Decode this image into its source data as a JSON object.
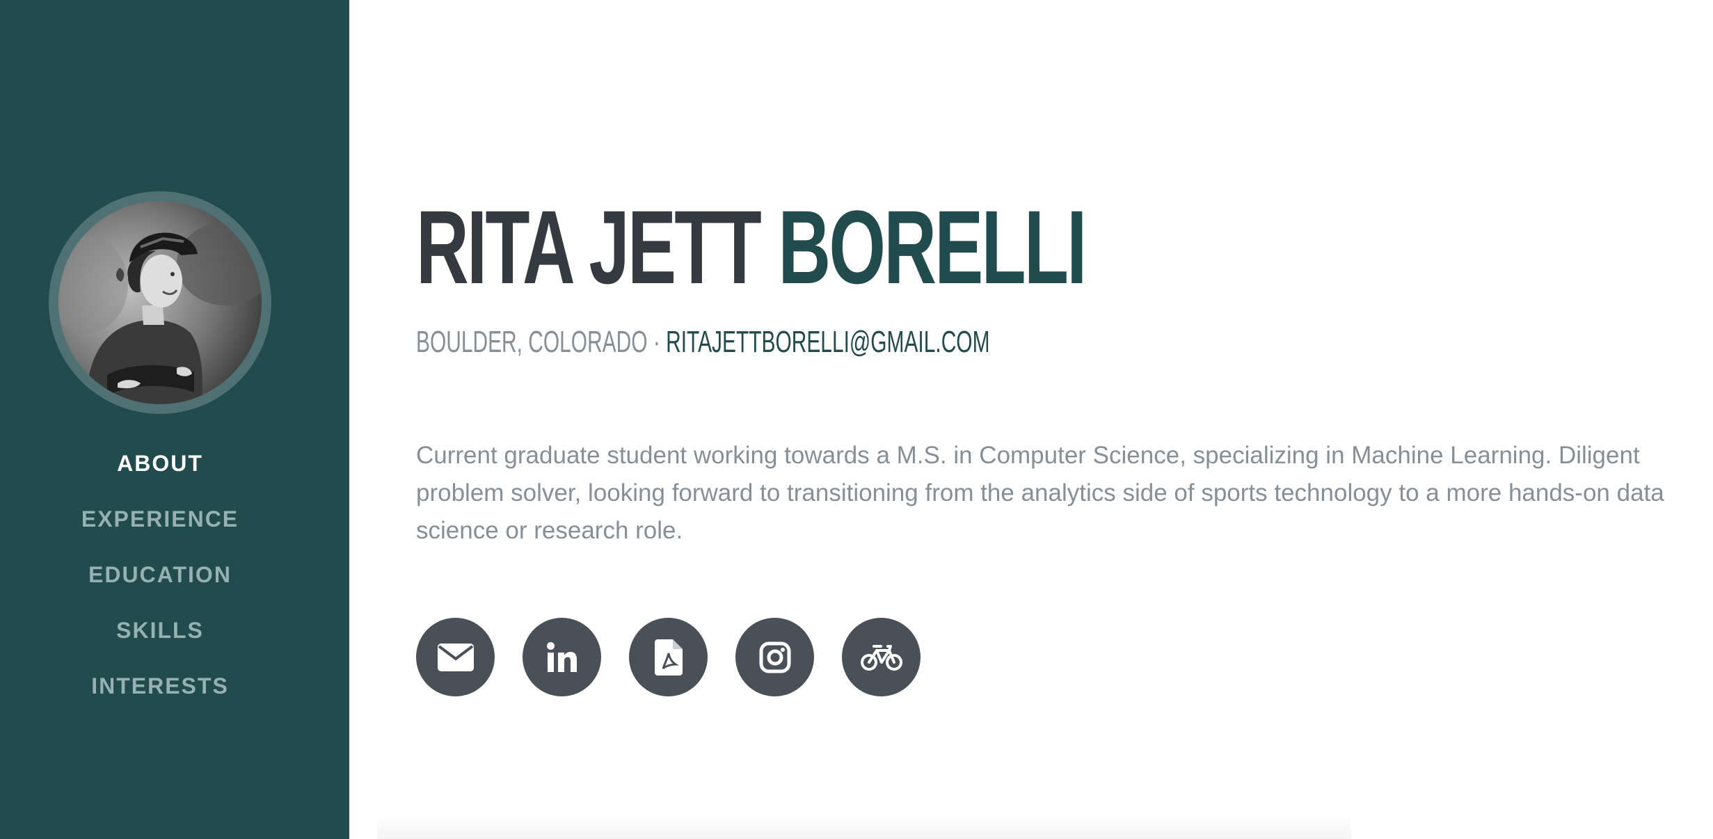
{
  "sidebar": {
    "avatar_alt": "Profile photo",
    "nav": [
      {
        "label": "ABOUT",
        "active": true
      },
      {
        "label": "EXPERIENCE",
        "active": false
      },
      {
        "label": "EDUCATION",
        "active": false
      },
      {
        "label": "SKILLS",
        "active": false
      },
      {
        "label": "INTERESTS",
        "active": false
      }
    ]
  },
  "header": {
    "first_name": "RITA JETT",
    "last_name": "BORELLI",
    "location": "BOULDER, COLORADO",
    "separator": "·",
    "email": "RITAJETTBORELLI@GMAIL.COM"
  },
  "about": {
    "bio": "Current graduate student working towards a M.S. in Computer Science, specializing in Machine Learning. Diligent problem solver, looking forward to transitioning from the analytics side of sports technology to a more hands-on data science or research role."
  },
  "social": [
    {
      "icon": "envelope-icon"
    },
    {
      "icon": "linkedin-icon"
    },
    {
      "icon": "pdf-file-icon"
    },
    {
      "icon": "instagram-icon"
    },
    {
      "icon": "bicycle-icon"
    }
  ],
  "colors": {
    "sidebar_bg": "#224b4d",
    "nav_active": "#ffffff",
    "nav_inactive": "#96b1b1",
    "name_dark": "#343a40",
    "accent": "#224b4d",
    "muted_text": "#868e96",
    "icon_button_bg": "#495057"
  }
}
